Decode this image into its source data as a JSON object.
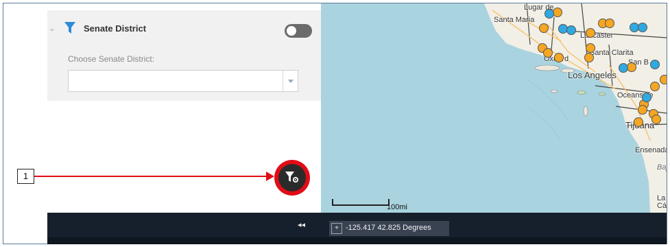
{
  "annotation": {
    "number": "1"
  },
  "filter": {
    "title": "Senate District",
    "choose_label": "Choose Senate District:",
    "selected_value": "",
    "toggle_on": false
  },
  "bottom_bar": {
    "collapse_glyph": "◂◂",
    "coordinates": "-125.417 42.825 Degrees"
  },
  "map": {
    "scale_label": "100mi",
    "places": {
      "santa_maria": "Santa Maria",
      "lancaster": "Lancaster",
      "oxnard": "Oxnard",
      "santa_clarita": "Santa Clarita",
      "los_angeles": "Los Angeles",
      "san_b": "San B",
      "oceanside": "Oceanside",
      "tijuana": "Tijuana",
      "ensenada": "Ensenada",
      "baja": "Baja",
      "cut_top": "Lugar de",
      "cut_la": "La",
      "cut_ca": "Cá"
    },
    "marker_colors": {
      "orange": "#f5a623",
      "blue": "#2fa9e0"
    }
  },
  "icons": [
    "chevron-down-icon",
    "funnel-icon",
    "filter-settings-icon",
    "crosshair-icon",
    "collapse-icon"
  ]
}
